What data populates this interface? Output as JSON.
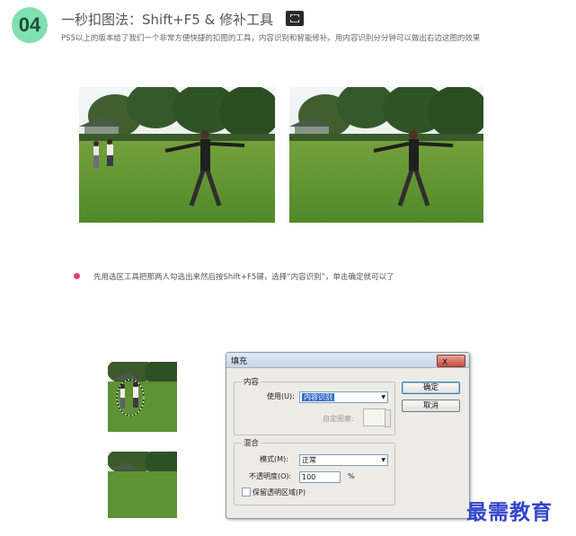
{
  "header": {
    "step_number": "04",
    "title": "一秒扣图法：Shift+F5 & 修补工具",
    "subtitle": "PS5以上的版本给了我们一个非常方便快捷的扣图的工具，内容识别和智能修补。用内容识别分分钟可以做出右边这图的效果"
  },
  "instruction": {
    "text": "先用选区工具把那两人勾选出来然后按Shift+F5键，选择“内容识别”，单击确定就可以了"
  },
  "dialog": {
    "title": "填充",
    "close_label": "X",
    "contents_group_label": "内容",
    "use_label": "使用(U):",
    "use_value": "内容识别",
    "custom_pattern_label": "自定图案:",
    "blending_group_label": "混合",
    "mode_label": "模式(M):",
    "mode_value": "正常",
    "opacity_label": "不透明度(O):",
    "opacity_value": "100",
    "opacity_unit": "%",
    "preserve_transparency_label": "保留透明区域(P)",
    "ok_label": "确定",
    "cancel_label": "取消"
  },
  "watermark": {
    "text": "最需教育"
  },
  "colors": {
    "badge": "#7fe0b0",
    "bullet": "#e0407a",
    "selection_highlight": "#3169c6",
    "watermark": "#3344cc"
  }
}
